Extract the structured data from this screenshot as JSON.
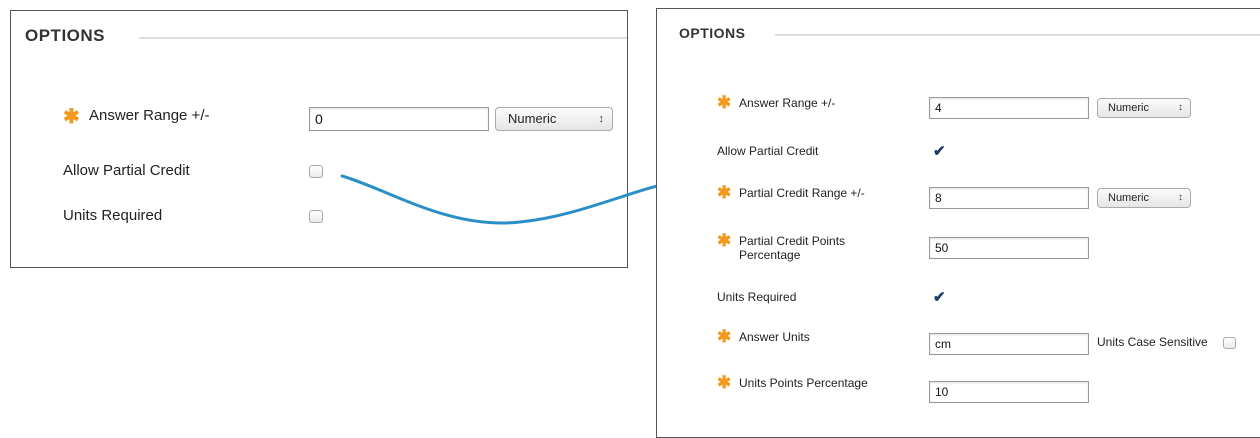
{
  "before_panel": {
    "section_title": "OPTIONS",
    "answer_range": {
      "required_mark": "✱",
      "label": "Answer Range +/-",
      "value": "0",
      "unit_type": "Numeric",
      "select_arrows": "↕"
    },
    "allow_partial_credit": {
      "label": "Allow Partial Credit",
      "checked": false
    },
    "units_required": {
      "label": "Units Required",
      "checked": false
    }
  },
  "after_panel": {
    "section_title": "OPTIONS",
    "answer_range": {
      "required_mark": "✱",
      "label": "Answer Range +/-",
      "value": "4",
      "unit_type": "Numeric",
      "select_arrows": "↕"
    },
    "allow_partial_credit": {
      "label": "Allow Partial Credit",
      "checked": true,
      "checkmark": "✔"
    },
    "partial_credit_range": {
      "required_mark": "✱",
      "label": "Partial Credit Range +/-",
      "value": "8",
      "unit_type": "Numeric",
      "select_arrows": "↕"
    },
    "partial_credit_points_percentage": {
      "required_mark": "✱",
      "label_line1": "Partial Credit Points",
      "label_line2": "Percentage",
      "value": "50"
    },
    "units_required": {
      "label": "Units Required",
      "checked": true,
      "checkmark": "✔"
    },
    "answer_units": {
      "required_mark": "✱",
      "label": "Answer Units",
      "value": "cm",
      "case_sensitive_label": "Units Case Sensitive",
      "case_sensitive_checked": false
    },
    "units_points_percentage": {
      "required_mark": "✱",
      "label": "Units Points Percentage",
      "value": "10"
    }
  },
  "colors": {
    "required_star": "#f39a1d",
    "transition_arrow": "#2b8fc7",
    "checkmark": "#1f3a66"
  },
  "icons": {
    "required": "asterisk-icon",
    "select": "updown-arrows-icon",
    "transition": "curved-arrow-icon",
    "check": "checkmark-icon"
  }
}
